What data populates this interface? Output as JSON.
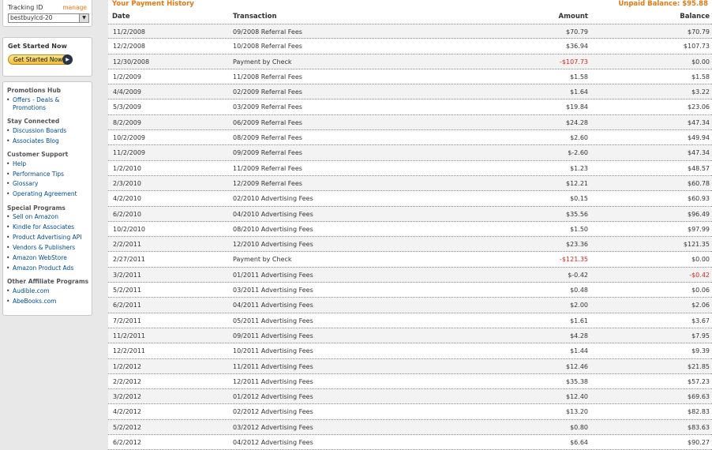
{
  "sidebar": {
    "tracking": {
      "label": "Tracking ID",
      "manage": "manage",
      "selected": "bestbuylcd-20"
    },
    "get_started": {
      "title": "Get Started Now",
      "button": "Get Started Now"
    },
    "sections": [
      {
        "title": "Promotions Hub",
        "items": [
          "Offers - Deals &",
          "Promotions"
        ]
      },
      {
        "title": "Stay Connected",
        "items": [
          "Discussion Boards",
          "Associates Blog"
        ]
      },
      {
        "title": "Customer Support",
        "items": [
          "Help",
          "Performance Tips",
          "Glossary",
          "Operating Agreement"
        ]
      },
      {
        "title": "Special Programs",
        "items": [
          "Sell on Amazon",
          "Kindle for Associates",
          "Product Advertising API",
          "Vendors & Publishers",
          "Amazon WebStore",
          "Amazon Product Ads"
        ]
      },
      {
        "title": "Other Affiliate Programs",
        "items": [
          "Audible.com",
          "AbeBooks.com"
        ]
      }
    ]
  },
  "main": {
    "title": "Your Payment History",
    "unpaid_balance": "Unpaid Balance: $95.88",
    "columns": {
      "date": "Date",
      "transaction": "Transaction",
      "amount": "Amount",
      "balance": "Balance"
    },
    "rows": [
      {
        "date": "11/2/2008",
        "transaction": "09/2008 Referral Fees",
        "amount": "$70.79",
        "balance": "$70.79",
        "amount_neg": false,
        "balance_neg": false
      },
      {
        "date": "12/2/2008",
        "transaction": "10/2008 Referral Fees",
        "amount": "$36.94",
        "balance": "$107.73",
        "amount_neg": false,
        "balance_neg": false
      },
      {
        "date": "12/30/2008",
        "transaction": "Payment by Check",
        "amount": "-$107.73",
        "balance": "$0.00",
        "amount_neg": true,
        "balance_neg": false
      },
      {
        "date": "1/2/2009",
        "transaction": "11/2008 Referral Fees",
        "amount": "$1.58",
        "balance": "$1.58",
        "amount_neg": false,
        "balance_neg": false
      },
      {
        "date": "4/4/2009",
        "transaction": "02/2009 Referral Fees",
        "amount": "$1.64",
        "balance": "$3.22",
        "amount_neg": false,
        "balance_neg": false
      },
      {
        "date": "5/3/2009",
        "transaction": "03/2009 Referral Fees",
        "amount": "$19.84",
        "balance": "$23.06",
        "amount_neg": false,
        "balance_neg": false
      },
      {
        "date": "8/2/2009",
        "transaction": "06/2009 Referral Fees",
        "amount": "$24.28",
        "balance": "$47.34",
        "amount_neg": false,
        "balance_neg": false
      },
      {
        "date": "10/2/2009",
        "transaction": "08/2009 Referral Fees",
        "amount": "$2.60",
        "balance": "$49.94",
        "amount_neg": false,
        "balance_neg": false
      },
      {
        "date": "11/2/2009",
        "transaction": "09/2009 Referral Fees",
        "amount": "$-2.60",
        "balance": "$47.34",
        "amount_neg": false,
        "balance_neg": false
      },
      {
        "date": "1/2/2010",
        "transaction": "11/2009 Referral Fees",
        "amount": "$1.23",
        "balance": "$48.57",
        "amount_neg": false,
        "balance_neg": false
      },
      {
        "date": "2/3/2010",
        "transaction": "12/2009 Referral Fees",
        "amount": "$12.21",
        "balance": "$60.78",
        "amount_neg": false,
        "balance_neg": false
      },
      {
        "date": "4/2/2010",
        "transaction": "02/2010 Advertising Fees",
        "amount": "$0.15",
        "balance": "$60.93",
        "amount_neg": false,
        "balance_neg": false
      },
      {
        "date": "6/2/2010",
        "transaction": "04/2010 Advertising Fees",
        "amount": "$35.56",
        "balance": "$96.49",
        "amount_neg": false,
        "balance_neg": false
      },
      {
        "date": "10/2/2010",
        "transaction": "08/2010 Advertising Fees",
        "amount": "$1.50",
        "balance": "$97.99",
        "amount_neg": false,
        "balance_neg": false
      },
      {
        "date": "2/2/2011",
        "transaction": "12/2010 Advertising Fees",
        "amount": "$23.36",
        "balance": "$121.35",
        "amount_neg": false,
        "balance_neg": false
      },
      {
        "date": "2/27/2011",
        "transaction": "Payment by Check",
        "amount": "-$121.35",
        "balance": "$0.00",
        "amount_neg": true,
        "balance_neg": false
      },
      {
        "date": "3/2/2011",
        "transaction": "01/2011 Advertising Fees",
        "amount": "$-0.42",
        "balance": "-$0.42",
        "amount_neg": false,
        "balance_neg": true
      },
      {
        "date": "5/2/2011",
        "transaction": "03/2011 Advertising Fees",
        "amount": "$0.48",
        "balance": "$0.06",
        "amount_neg": false,
        "balance_neg": false
      },
      {
        "date": "6/2/2011",
        "transaction": "04/2011 Advertising Fees",
        "amount": "$2.00",
        "balance": "$2.06",
        "amount_neg": false,
        "balance_neg": false
      },
      {
        "date": "7/2/2011",
        "transaction": "05/2011 Advertising Fees",
        "amount": "$1.61",
        "balance": "$3.67",
        "amount_neg": false,
        "balance_neg": false
      },
      {
        "date": "11/2/2011",
        "transaction": "09/2011 Advertising Fees",
        "amount": "$4.28",
        "balance": "$7.95",
        "amount_neg": false,
        "balance_neg": false
      },
      {
        "date": "12/2/2011",
        "transaction": "10/2011 Advertising Fees",
        "amount": "$1.44",
        "balance": "$9.39",
        "amount_neg": false,
        "balance_neg": false
      },
      {
        "date": "1/2/2012",
        "transaction": "11/2011 Advertising Fees",
        "amount": "$12.46",
        "balance": "$21.85",
        "amount_neg": false,
        "balance_neg": false
      },
      {
        "date": "2/2/2012",
        "transaction": "12/2011 Advertising Fees",
        "amount": "$35.38",
        "balance": "$57.23",
        "amount_neg": false,
        "balance_neg": false
      },
      {
        "date": "3/2/2012",
        "transaction": "01/2012 Advertising Fees",
        "amount": "$12.40",
        "balance": "$69.63",
        "amount_neg": false,
        "balance_neg": false
      },
      {
        "date": "4/2/2012",
        "transaction": "02/2012 Advertising Fees",
        "amount": "$13.20",
        "balance": "$82.83",
        "amount_neg": false,
        "balance_neg": false
      },
      {
        "date": "5/2/2012",
        "transaction": "03/2012 Advertising Fees",
        "amount": "$0.80",
        "balance": "$83.63",
        "amount_neg": false,
        "balance_neg": false
      },
      {
        "date": "6/2/2012",
        "transaction": "04/2012 Advertising Fees",
        "amount": "$6.64",
        "balance": "$90.27",
        "amount_neg": false,
        "balance_neg": false
      }
    ]
  },
  "colors": {
    "accent": "#e47911",
    "link": "#004b91",
    "negative": "#e0201b"
  }
}
